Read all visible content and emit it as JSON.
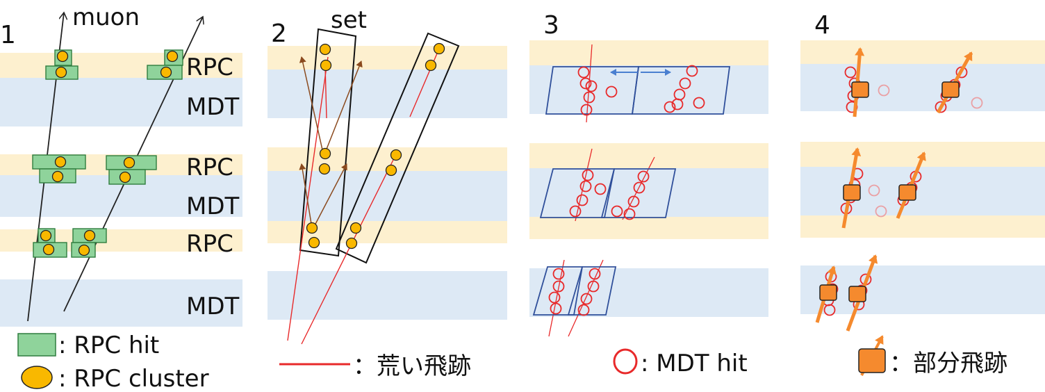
{
  "panel_numbers": [
    "1",
    "2",
    "3",
    "4"
  ],
  "panel1": {
    "muon_label": "muon",
    "layer_labels": [
      "RPC",
      "MDT",
      "RPC",
      "MDT",
      "RPC",
      "MDT"
    ]
  },
  "panel2": {
    "set_label": "set"
  },
  "legend": {
    "rpc_hit": ": RPC hit",
    "rpc_cluster": ": RPC cluster",
    "rough_track": "：荒い飛跡",
    "mdt_hit": ": MDT hit",
    "segment": "：部分飛跡"
  },
  "colors": {
    "rpc_band": "#fdf0cf",
    "mdt_band": "#dde9f5",
    "rpc_hit_fill": "#8fd39b",
    "rpc_hit_stroke": "#2f7d3e",
    "cluster_fill": "#f9b800",
    "rough_track": "#e8292a",
    "mdt_hit": "#e8292a",
    "window": "#2f4f9a",
    "segment": "#f58a2e",
    "arrow_brown": "#8b4a1e"
  }
}
